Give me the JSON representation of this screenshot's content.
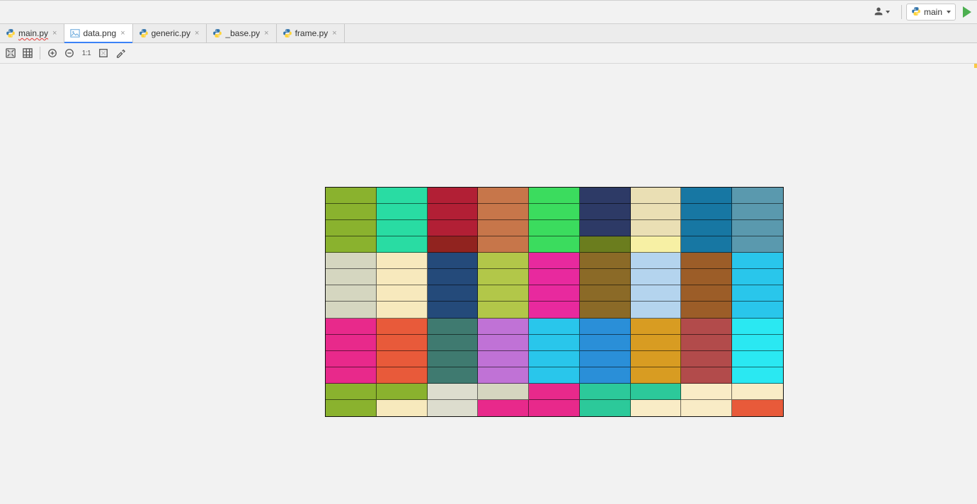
{
  "top": {
    "run_config_label": "main"
  },
  "tabs": [
    {
      "id": "main",
      "label": "main.py",
      "type": "py",
      "active": false
    },
    {
      "id": "data",
      "label": "data.png",
      "type": "img",
      "active": true
    },
    {
      "id": "generic",
      "label": "generic.py",
      "type": "py",
      "active": false
    },
    {
      "id": "base",
      "label": "_base.py",
      "type": "py",
      "active": false
    },
    {
      "id": "frame",
      "label": "frame.py",
      "type": "py",
      "active": false
    }
  ],
  "img_toolbar": {
    "one_to_one_label": "1:1"
  },
  "colors": {
    "olive": "#8ab22e",
    "mint": "#29dca3",
    "crimson": "#b21f35",
    "sienna": "#c7764a",
    "green": "#3bdc5e",
    "navy": "#2d3a66",
    "beige": "#eadfb4",
    "tealblue": "#1777a3",
    "steel": "#5a99ae",
    "brick": "#91231f",
    "darkolive": "#6b7d1e",
    "lightyel": "#f7f0a4",
    "putty": "#d5d6c0",
    "cream": "#f7e9bd",
    "darkblue": "#244a7a",
    "yelgreen": "#b2c749",
    "magenta": "#e8299e",
    "brown": "#8b6a27",
    "lightblue": "#b4d4ee",
    "saddlebwn": "#9c5d28",
    "cyan": "#29c6eb",
    "hotpink": "#e8298b",
    "tomato": "#e85a3a",
    "slate": "#3f7a70",
    "orchid": "#c072d6",
    "azure": "#2a8fd8",
    "goldenrod": "#d89c22",
    "indianred": "#b24b4b",
    "aqua": "#2ae8f2",
    "seagreen": "#2cc99a",
    "offwhite": "#ddddce",
    "lightcream": "#f9ecc6"
  },
  "grid": {
    "note": "14 rows × 9 columns of color cells. Values are keys into colors above.",
    "cells": [
      [
        "olive",
        "mint",
        "crimson",
        "sienna",
        "green",
        "navy",
        "beige",
        "tealblue",
        "steel"
      ],
      [
        "olive",
        "mint",
        "crimson",
        "sienna",
        "green",
        "navy",
        "beige",
        "tealblue",
        "steel"
      ],
      [
        "olive",
        "mint",
        "crimson",
        "sienna",
        "green",
        "navy",
        "beige",
        "tealblue",
        "steel"
      ],
      [
        "olive",
        "mint",
        "brick",
        "sienna",
        "green",
        "darkolive",
        "lightyel",
        "tealblue",
        "steel"
      ],
      [
        "putty",
        "cream",
        "darkblue",
        "yelgreen",
        "magenta",
        "brown",
        "lightblue",
        "saddlebwn",
        "cyan"
      ],
      [
        "putty",
        "cream",
        "darkblue",
        "yelgreen",
        "magenta",
        "brown",
        "lightblue",
        "saddlebwn",
        "cyan"
      ],
      [
        "putty",
        "cream",
        "darkblue",
        "yelgreen",
        "magenta",
        "brown",
        "lightblue",
        "saddlebwn",
        "cyan"
      ],
      [
        "putty",
        "cream",
        "darkblue",
        "yelgreen",
        "magenta",
        "brown",
        "lightblue",
        "saddlebwn",
        "cyan"
      ],
      [
        "hotpink",
        "tomato",
        "slate",
        "orchid",
        "cyan",
        "azure",
        "goldenrod",
        "indianred",
        "aqua"
      ],
      [
        "hotpink",
        "tomato",
        "slate",
        "orchid",
        "cyan",
        "azure",
        "goldenrod",
        "indianred",
        "aqua"
      ],
      [
        "hotpink",
        "tomato",
        "slate",
        "orchid",
        "cyan",
        "azure",
        "goldenrod",
        "indianred",
        "aqua"
      ],
      [
        "hotpink",
        "tomato",
        "slate",
        "orchid",
        "cyan",
        "azure",
        "goldenrod",
        "indianred",
        "aqua"
      ],
      [
        "olive",
        "olive",
        "offwhite",
        "putty",
        "hotpink",
        "seagreen",
        "seagreen",
        "lightcream",
        "lightcream"
      ],
      [
        "olive",
        "cream",
        "offwhite",
        "hotpink",
        "hotpink",
        "seagreen",
        "lightcream",
        "lightcream",
        "tomato"
      ]
    ]
  }
}
